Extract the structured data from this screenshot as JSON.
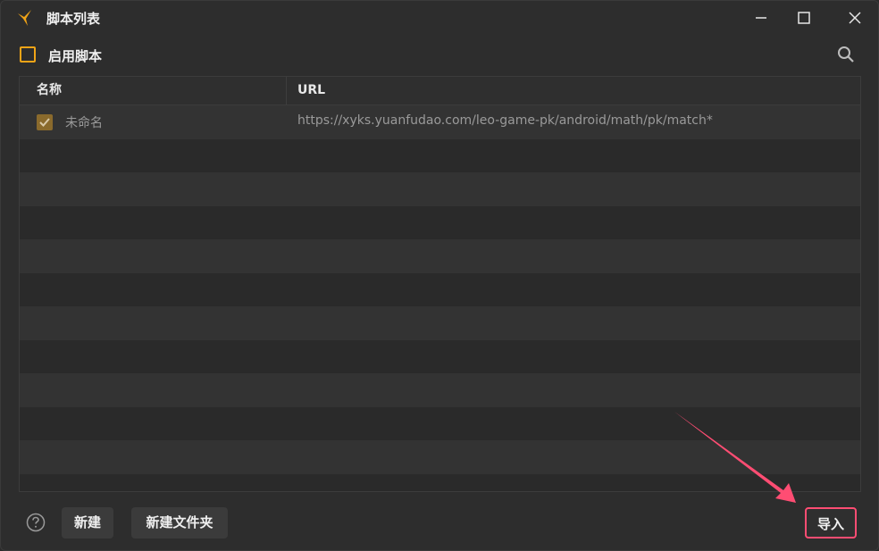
{
  "window": {
    "title": "脚本列表"
  },
  "toolbar": {
    "enable_label": "启用脚本",
    "enable_checked": false
  },
  "table": {
    "columns": [
      "名称",
      "URL"
    ],
    "rows": [
      {
        "enabled": true,
        "name": "未命名",
        "url": "https://xyks.yuanfudao.com/leo-game-pk/android/math/pk/match*"
      }
    ]
  },
  "footer": {
    "new_label": "新建",
    "new_folder_label": "新建文件夹",
    "import_label": "导入"
  },
  "colors": {
    "accent": "#f0a417",
    "highlight": "#ff4d73"
  },
  "icons": {
    "logo": "app-logo-icon",
    "minimize": "minimize-icon",
    "maximize": "maximize-icon",
    "close": "close-icon",
    "search": "search-icon",
    "help": "help-icon",
    "check": "check-icon",
    "annotation": "annotation-arrow"
  }
}
